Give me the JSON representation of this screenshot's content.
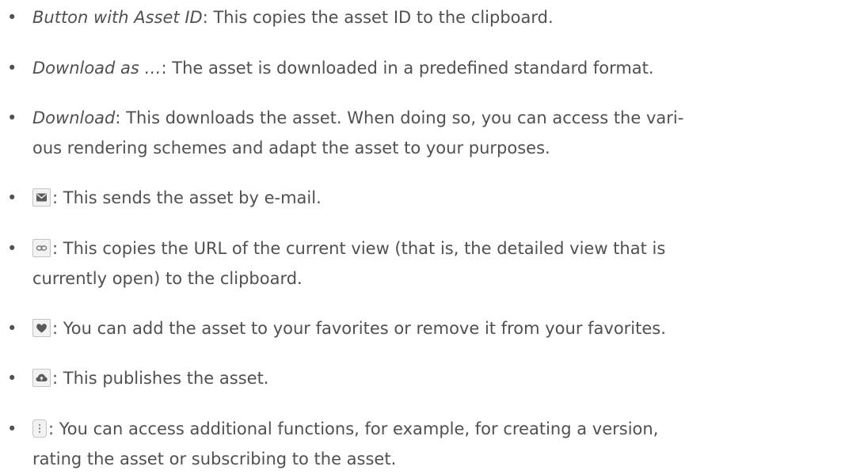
{
  "items": [
    {
      "term": "Button with Asset ID",
      "line1": ": This copies the asset ID to the clipboard."
    },
    {
      "term": "Download as …",
      "line1": ": The asset is downloaded in a predefined standard format."
    },
    {
      "term": "Download",
      "line1": ": This downloads the asset. When doing so, you can access the vari-",
      "line2": "ous rendering schemes and adapt the asset to your purposes."
    },
    {
      "icon": "email-icon",
      "line1": ": This sends the asset by e-mail."
    },
    {
      "icon": "link-icon",
      "line1": ": This copies the URL of the current view (that is, the detailed view that is",
      "line2": "currently open) to the clipboard."
    },
    {
      "icon": "heart-icon",
      "line1": ": You can add the asset to your favorites or remove it from your favorites."
    },
    {
      "icon": "cloud-upload-icon",
      "line1": ": This publishes the asset."
    },
    {
      "icon": "more-vertical-icon",
      "line1": ": You can access additional functions, for example, for creating a version,",
      "line2": "rating the asset or subscribing to the asset."
    }
  ],
  "bullet": "•"
}
